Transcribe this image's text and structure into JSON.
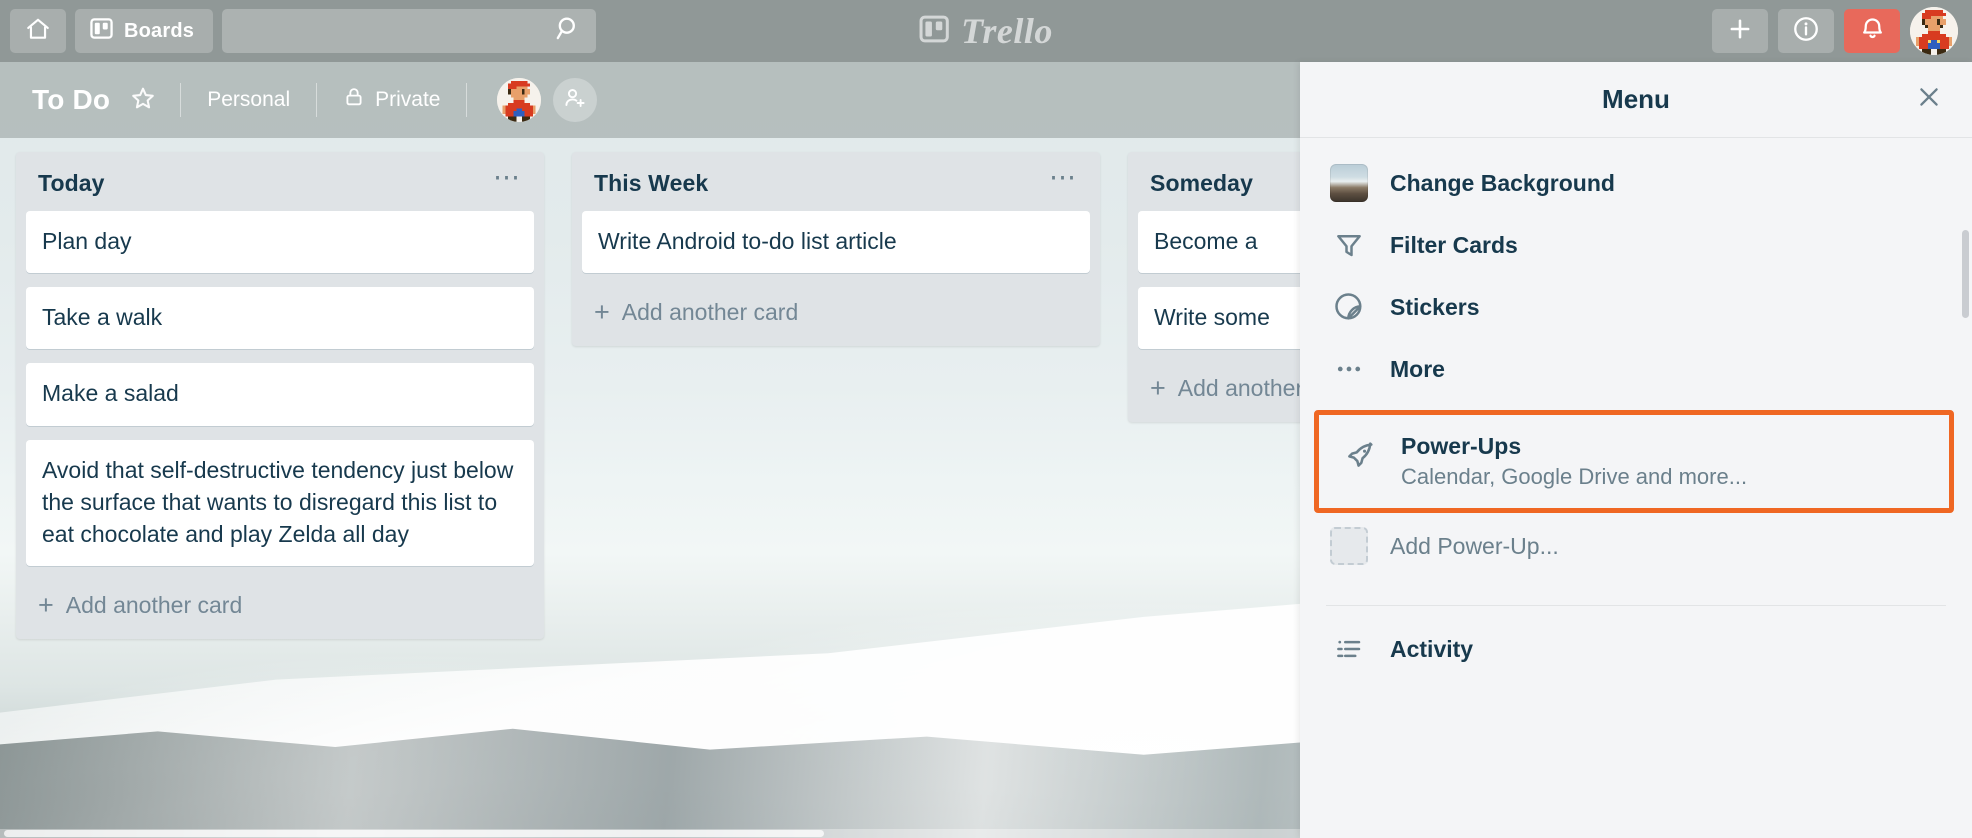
{
  "top_bar": {
    "home_icon": "home-icon",
    "boards_label": "Boards",
    "boards_icon": "boards-icon",
    "search": {
      "value": "",
      "placeholder": "",
      "icon": "search-icon"
    },
    "logo_text": "Trello",
    "logo_icon": "trello-logo-icon",
    "add_icon": "plus-icon",
    "info_icon": "info-icon",
    "notifications_icon": "bell-icon",
    "notifications_color": "#e8695b",
    "avatar": "mario-avatar"
  },
  "board_bar": {
    "title": "To Do",
    "star_icon": "star-icon",
    "team": "Personal",
    "visibility": "Private",
    "visibility_icon": "lock-icon",
    "member_avatar": "mario-avatar",
    "add_member_icon": "add-member-icon"
  },
  "lists": [
    {
      "title": "Today",
      "menu_icon": "list-menu-icon",
      "cards": [
        "Plan day",
        "Take a walk",
        "Make a salad",
        "Avoid that self-destructive tendency just below the surface that wants to disregard this list to eat chocolate and play Zelda all day"
      ],
      "add_card": "Add another card"
    },
    {
      "title": "This Week",
      "menu_icon": "list-menu-icon",
      "cards": [
        "Write Android to-do list article"
      ],
      "add_card": "Add another card"
    },
    {
      "title": "Someday",
      "menu_icon": "list-menu-icon",
      "cards": [
        "Become a ",
        "Write some"
      ],
      "add_card": "Add another card"
    }
  ],
  "sidebar": {
    "title": "Menu",
    "close_icon": "close-icon",
    "items": [
      {
        "label": "Change Background",
        "icon": "background-thumbnail-icon"
      },
      {
        "label": "Filter Cards",
        "icon": "filter-icon"
      },
      {
        "label": "Stickers",
        "icon": "sticker-icon"
      },
      {
        "label": "More",
        "icon": "more-icon"
      }
    ],
    "powerups": {
      "label": "Power-Ups",
      "subtitle": "Calendar, Google Drive and more...",
      "icon": "rocket-icon",
      "highlight_color": "#ef6723"
    },
    "add_powerup": {
      "label": "Add Power-Up...",
      "icon": "add-powerup-placeholder-icon"
    },
    "activity": {
      "label": "Activity",
      "icon": "activity-list-icon"
    }
  }
}
